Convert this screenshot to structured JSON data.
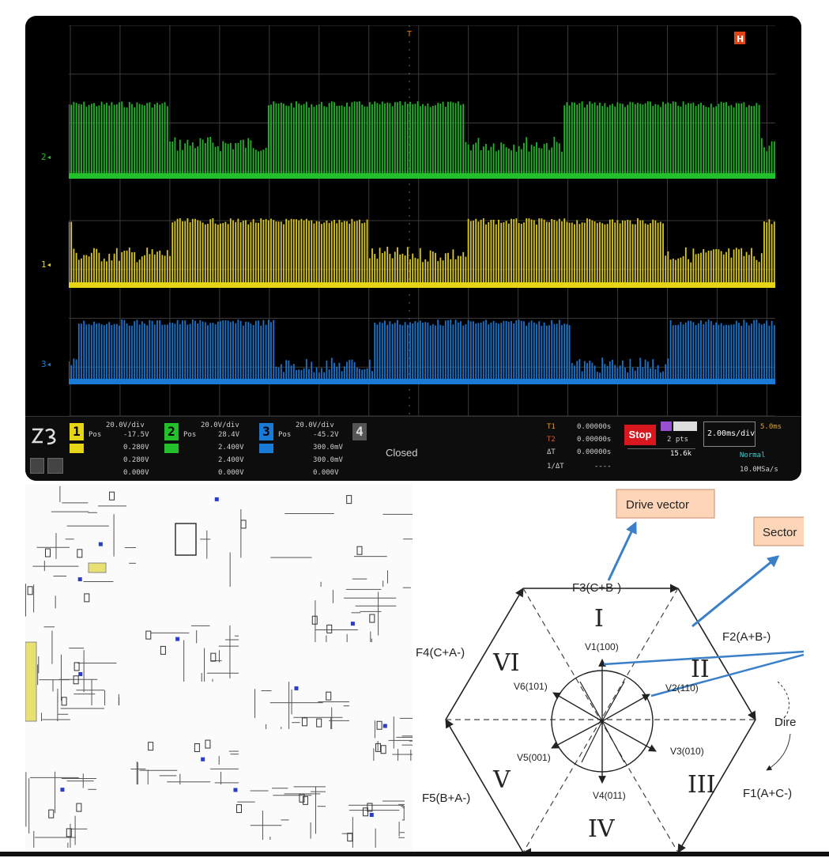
{
  "scope": {
    "screen_label_top": "T",
    "h_marker": "H",
    "channel_markers": [
      {
        "label": "2",
        "color": "#22c02a"
      },
      {
        "label": "1",
        "color": "#e6d417"
      },
      {
        "label": "3",
        "color": "#1a7ad8"
      }
    ],
    "channels": [
      {
        "num": "1",
        "color": "#e6d417",
        "scale": "20.0V/div",
        "pos_label": "Pos",
        "pos_value": "-17.5V",
        "row2": "0.280V",
        "row3": "0.280V",
        "row4": "0.000V"
      },
      {
        "num": "2",
        "color": "#22c02a",
        "scale": "20.0V/div",
        "pos_label": "Pos",
        "pos_value": "28.4V",
        "row2": "2.400V",
        "row3": "2.400V",
        "row4": "0.000V"
      },
      {
        "num": "3",
        "color": "#1a7ad8",
        "scale": "20.0V/div",
        "pos_label": "Pos",
        "pos_value": "-45.2V",
        "row2": "300.0mV",
        "row3": "300.0mV",
        "row4": "0.000V"
      }
    ],
    "channel4": {
      "num": "4",
      "status": "Closed"
    },
    "cursors": [
      {
        "label": "T1",
        "value": "0.00000s"
      },
      {
        "label": "T2",
        "value": "0.00000s"
      },
      {
        "label": "ΔT",
        "value": "0.00000s"
      },
      {
        "label": "1/ΔT",
        "value": "----"
      }
    ],
    "run_state": "Stop",
    "acq_points": "2 pts",
    "acq_value": "15.6k",
    "timebase": "2.00ms/div",
    "trigger_pos": "5.0ms",
    "sample_rate": "10.0MSa/s",
    "mode": "Normal"
  },
  "diagram": {
    "callout_drive": "Drive vector",
    "callout_sector": "Sector",
    "top_edge": "F3(C+B-)",
    "right_upper_edge": "F2(A+B-)",
    "left_upper_edge": "F4(C+A-)",
    "left_lower_edge": "F5(B+A-)",
    "right_lower_edge": "F1(A+C-)",
    "direction": "Dire",
    "sectors": {
      "s1": "I",
      "s2": "II",
      "s3": "III",
      "s4": "IV",
      "s5": "V",
      "s6": "VI"
    },
    "vectors": {
      "v1": "V1(100)",
      "v2": "V2(110)",
      "v3": "V3(010)",
      "v4": "V4(011)",
      "v5": "V5(001)",
      "v6": "V6(101)"
    }
  }
}
